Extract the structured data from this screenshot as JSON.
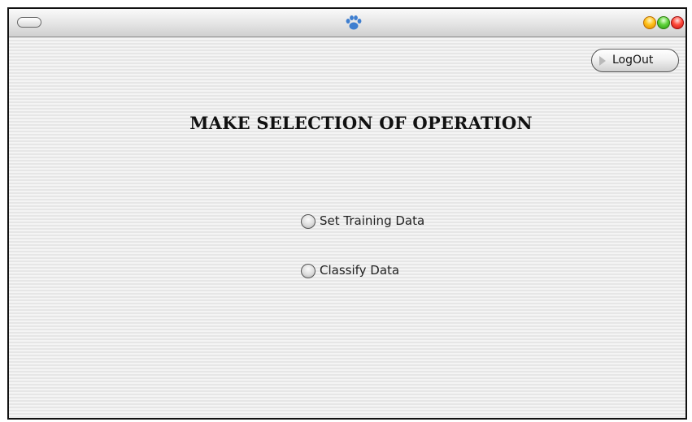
{
  "window": {
    "title_icon": "paw-icon"
  },
  "toolbar": {
    "logout_label": "LogOut"
  },
  "main": {
    "title": "MAKE SELECTION OF OPERATION",
    "options": [
      {
        "label": "Set Training Data",
        "selected": false
      },
      {
        "label": "Classify Data",
        "selected": false
      }
    ]
  },
  "colors": {
    "background": "#ededed",
    "titlebar": "#e4e4e4",
    "close": "#ff4b3b",
    "minimize": "#ffc21a",
    "maximize": "#5fd33b"
  }
}
